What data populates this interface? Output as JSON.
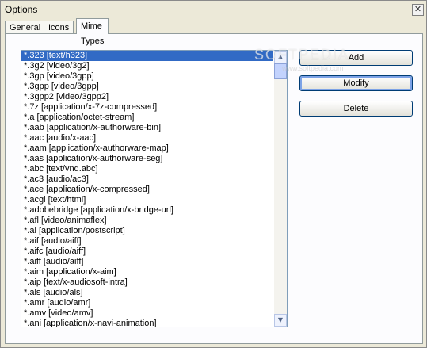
{
  "window": {
    "title": "Options",
    "close_glyph": "✕"
  },
  "tabs": [
    {
      "label": "General"
    },
    {
      "label": "Icons"
    },
    {
      "label": "Mime Types"
    }
  ],
  "active_tab": "Mime Types",
  "mime_list": {
    "selected_index": 0,
    "items": [
      "*.323 [text/h323]",
      "*.3g2 [video/3g2]",
      "*.3gp [video/3gpp]",
      "*.3gpp [video/3gpp]",
      "*.3gpp2 [video/3gpp2]",
      "*.7z [application/x-7z-compressed]",
      "*.a [application/octet-stream]",
      "*.aab [application/x-authorware-bin]",
      "*.aac [audio/x-aac]",
      "*.aam [application/x-authorware-map]",
      "*.aas [application/x-authorware-seg]",
      "*.abc [text/vnd.abc]",
      "*.ac3 [audio/ac3]",
      "*.ace [application/x-compressed]",
      "*.acgi [text/html]",
      "*.adobebridge [application/x-bridge-url]",
      "*.afl [video/animaflex]",
      "*.ai [application/postscript]",
      "*.aif [audio/aiff]",
      "*.aifc [audio/aiff]",
      "*.aiff [audio/aiff]",
      "*.aim [application/x-aim]",
      "*.aip [text/x-audiosoft-intra]",
      "*.als [audio/als]",
      "*.amr [audio/amr]",
      "*.amv [video/amv]",
      "*.ani [application/x-navi-animation]"
    ]
  },
  "buttons": {
    "add": "Add",
    "modify": "Modify",
    "delete": "Delete"
  },
  "scrollbar": {
    "up_glyph": "▲",
    "down_glyph": "▼"
  },
  "watermark": {
    "text": "SOFTPEDIA",
    "sub": "www.softpedia.com"
  },
  "colors": {
    "selection": "#316ac5",
    "background": "#ece9d8"
  }
}
